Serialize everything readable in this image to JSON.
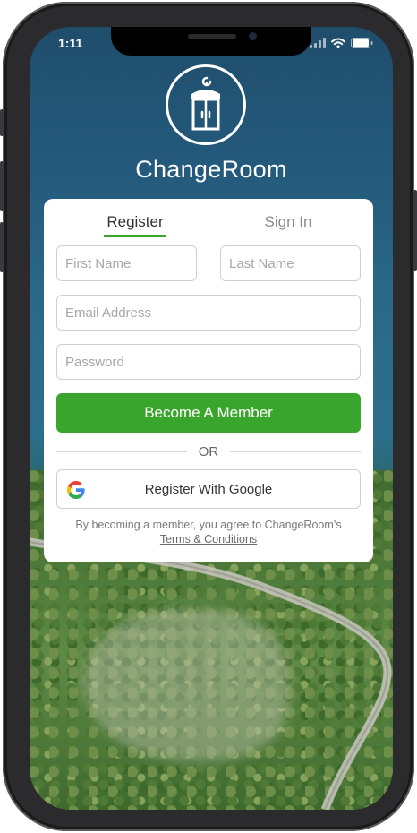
{
  "status_bar": {
    "time": "1:11"
  },
  "brand": {
    "name": "ChangeRoom",
    "accent_color": "#3aa52c"
  },
  "tabs": [
    {
      "label": "Register",
      "active": true
    },
    {
      "label": "Sign In",
      "active": false
    }
  ],
  "form": {
    "first_name": {
      "placeholder": "First Name",
      "value": ""
    },
    "last_name": {
      "placeholder": "Last Name",
      "value": ""
    },
    "email": {
      "placeholder": "Email Address",
      "value": ""
    },
    "password": {
      "placeholder": "Password",
      "value": ""
    },
    "submit_label": "Become A Member"
  },
  "divider_label": "OR",
  "google": {
    "label": "Register With Google",
    "icon": "google-g-icon"
  },
  "legal": {
    "text": "By becoming a member, you agree to ChangeRoom’s",
    "link_label": "Terms & Conditions"
  },
  "icons": [
    "wifi-icon",
    "battery-icon",
    "signal-icon",
    "changeroom-logo-icon"
  ]
}
